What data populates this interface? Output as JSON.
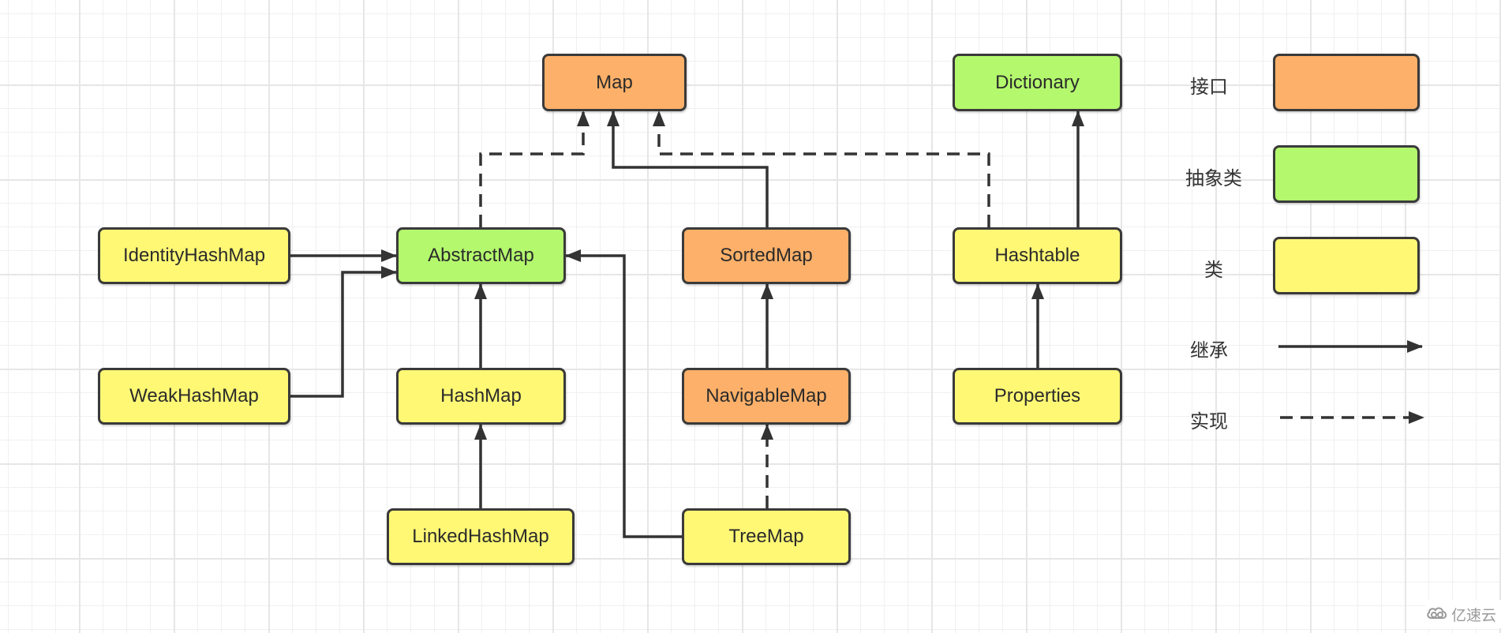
{
  "colors": {
    "interface": "#FDB069",
    "abstract_class": "#B4F86E",
    "class": "#FFF875",
    "line": "#333333"
  },
  "nodes": [
    {
      "id": "map",
      "label": "Map",
      "kind": "interface"
    },
    {
      "id": "dictionary",
      "label": "Dictionary",
      "kind": "abstract_class"
    },
    {
      "id": "identity-hash-map",
      "label": "IdentityHashMap",
      "kind": "class"
    },
    {
      "id": "abstract-map",
      "label": "AbstractMap",
      "kind": "abstract_class"
    },
    {
      "id": "sorted-map",
      "label": "SortedMap",
      "kind": "interface"
    },
    {
      "id": "hashtable",
      "label": "Hashtable",
      "kind": "class"
    },
    {
      "id": "weak-hash-map",
      "label": "WeakHashMap",
      "kind": "class"
    },
    {
      "id": "hash-map",
      "label": "HashMap",
      "kind": "class"
    },
    {
      "id": "navigable-map",
      "label": "NavigableMap",
      "kind": "interface"
    },
    {
      "id": "properties",
      "label": "Properties",
      "kind": "class"
    },
    {
      "id": "linked-hash-map",
      "label": "LinkedHashMap",
      "kind": "class"
    },
    {
      "id": "tree-map",
      "label": "TreeMap",
      "kind": "class"
    }
  ],
  "edges": [
    {
      "from": "abstract-map",
      "to": "map",
      "type": "implements"
    },
    {
      "from": "sorted-map",
      "to": "map",
      "type": "extends"
    },
    {
      "from": "hashtable",
      "to": "map",
      "type": "implements"
    },
    {
      "from": "hashtable",
      "to": "dictionary",
      "type": "extends"
    },
    {
      "from": "identity-hash-map",
      "to": "abstract-map",
      "type": "extends"
    },
    {
      "from": "weak-hash-map",
      "to": "abstract-map",
      "type": "extends"
    },
    {
      "from": "hash-map",
      "to": "abstract-map",
      "type": "extends"
    },
    {
      "from": "tree-map",
      "to": "abstract-map",
      "type": "extends"
    },
    {
      "from": "navigable-map",
      "to": "sorted-map",
      "type": "extends"
    },
    {
      "from": "properties",
      "to": "hashtable",
      "type": "extends"
    },
    {
      "from": "linked-hash-map",
      "to": "hash-map",
      "type": "extends"
    },
    {
      "from": "tree-map",
      "to": "navigable-map",
      "type": "implements"
    }
  ],
  "legend": {
    "interface_label": "接口",
    "abstract_class_label": "抽象类",
    "class_label": "类",
    "extends_label": "继承",
    "implements_label": "实现"
  },
  "watermark": {
    "icon": "cloud-icon",
    "text": "亿速云"
  }
}
